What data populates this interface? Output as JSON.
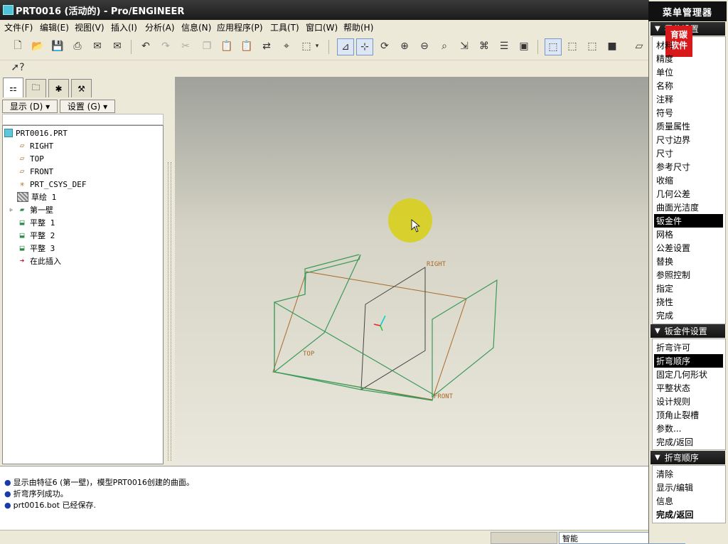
{
  "window": {
    "title": "PRT0016 (活动的) - Pro/ENGINEER"
  },
  "menubar": {
    "items": [
      "文件(F)",
      "编辑(E)",
      "视图(V)",
      "插入(I)",
      "分析(A)",
      "信息(N)",
      "应用程序(P)",
      "工具(T)",
      "窗口(W)",
      "帮助(H)"
    ]
  },
  "nav": {
    "show_button": "显示 (D) ▾",
    "settings_button": "设置 (G) ▾",
    "tree": [
      {
        "label": "PRT0016.PRT",
        "icon": "part-icon"
      },
      {
        "label": "RIGHT",
        "icon": "datum-plane-icon"
      },
      {
        "label": "TOP",
        "icon": "datum-plane-icon"
      },
      {
        "label": "FRONT",
        "icon": "datum-plane-icon"
      },
      {
        "label": "PRT_CSYS_DEF",
        "icon": "csys-icon"
      },
      {
        "label": "草绘 1",
        "icon": "sketch-icon"
      },
      {
        "label": "第一壁",
        "icon": "wall-icon"
      },
      {
        "label": "平整 1",
        "icon": "flat-wall-icon"
      },
      {
        "label": "平整 2",
        "icon": "flat-wall-icon"
      },
      {
        "label": "平整 3",
        "icon": "flat-wall-icon"
      },
      {
        "label": "在此插入",
        "icon": "insert-arrow-icon"
      }
    ]
  },
  "graphics": {
    "datum_labels": {
      "right": "RIGHT",
      "top": "TOP",
      "front": "FRONT"
    }
  },
  "messages": [
    "显示由特征6 (第一壁)，模型PRT0016创建的曲面。",
    "折弯序列成功。",
    "prt0016.bot 已经保存."
  ],
  "statusbar": {
    "filter_value": "智能"
  },
  "menu_manager": {
    "title": "菜单管理器",
    "logo_text": "育碳软件",
    "part_setup": {
      "header": "零件设置",
      "items": [
        "材料",
        "精度",
        "单位",
        "名称",
        "注释",
        "符号",
        "质量属性",
        "尺寸边界",
        "尺寸",
        "参考尺寸",
        "收缩",
        "几何公差",
        "曲面光洁度",
        "钣金件",
        "网格",
        "公差设置",
        "替换",
        "参照控制",
        "指定",
        "挠性",
        "完成"
      ],
      "selected": "钣金件"
    },
    "sheetmetal_setup": {
      "header": "钣金件设置",
      "items": [
        "折弯许可",
        "折弯顺序",
        "固定几何形状",
        "平整状态",
        "设计规则",
        "顶角止裂槽",
        "参数...",
        "完成/返回"
      ],
      "selected": "折弯顺序"
    },
    "bend_order": {
      "header": "折弯顺序",
      "items": [
        "清除",
        "显示/编辑",
        "信息",
        "完成/返回"
      ],
      "bold": "完成/返回"
    }
  },
  "colors": {
    "titlebar": "#1b1b1b",
    "accent_green": "#3a9a5a",
    "datum_orange": "#a86a2a",
    "highlight": "#d8cf1c"
  }
}
